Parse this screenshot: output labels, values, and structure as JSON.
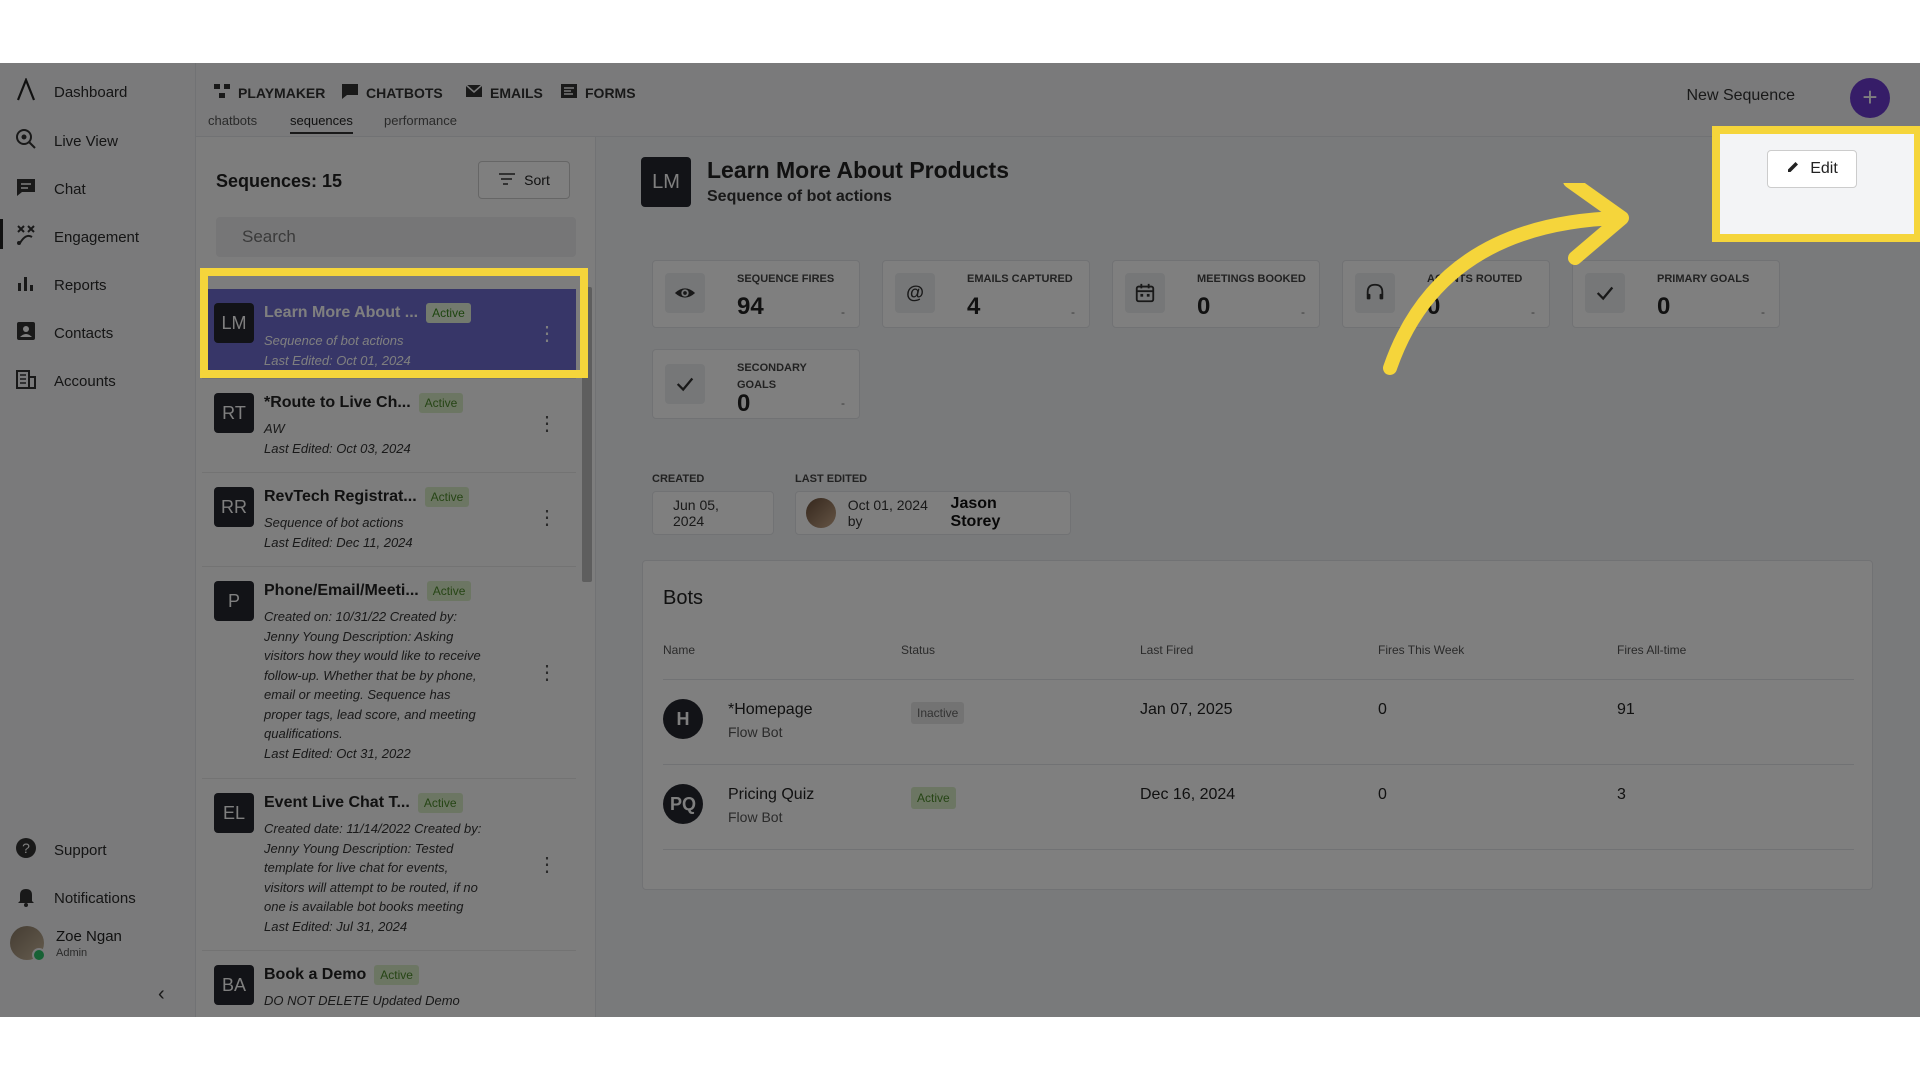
{
  "sidebar": {
    "items": [
      {
        "label": "Dashboard",
        "icon": "logo-icon"
      },
      {
        "label": "Live View",
        "icon": "live-view-icon"
      },
      {
        "label": "Chat",
        "icon": "chat-icon"
      },
      {
        "label": "Engagement",
        "icon": "engagement-icon"
      },
      {
        "label": "Reports",
        "icon": "bar-chart-icon"
      },
      {
        "label": "Contacts",
        "icon": "contacts-icon"
      },
      {
        "label": "Accounts",
        "icon": "building-icon"
      }
    ],
    "support": "Support",
    "notifications": "Notifications",
    "user": {
      "name": "Zoe Ngan",
      "role": "Admin"
    }
  },
  "topbar": {
    "tabs": [
      "PLAYMAKER",
      "CHATBOTS",
      "EMAILS",
      "FORMS"
    ],
    "subtabs": [
      "chatbots",
      "sequences",
      "performance"
    ],
    "active_subtab": "sequences",
    "new_sequence_label": "New Sequence",
    "accent": "#6c3bd1"
  },
  "list": {
    "count_label": "Sequences: 15",
    "sort_label": "Sort",
    "search_placeholder": "Search",
    "items": [
      {
        "initials": "LM",
        "title": "Learn More About ...",
        "status": "Active",
        "lines": [
          "Sequence of bot actions",
          "Last Edited: Oct 01, 2024"
        ]
      },
      {
        "initials": "RT",
        "title": "*Route to Live Ch...",
        "status": "Active",
        "lines": [
          "AW",
          "Last Edited: Oct 03, 2024"
        ]
      },
      {
        "initials": "RR",
        "title": "RevTech Registrat...",
        "status": "Active",
        "lines": [
          "Sequence of bot actions",
          "Last Edited: Dec 11, 2024"
        ]
      },
      {
        "initials": "P",
        "title": "Phone/Email/Meeti...",
        "status": "Active",
        "lines": [
          "Created on: 10/31/22 Created by:",
          "Jenny Young Description: Asking",
          "visitors how they would like to receive",
          "follow-up. Whether that be by phone,",
          "email or meeting. Sequence has",
          "proper tags, lead score, and meeting",
          "qualifications.",
          "Last Edited: Oct 31, 2022"
        ]
      },
      {
        "initials": "EL",
        "title": "Event Live Chat T...",
        "status": "Active",
        "lines": [
          "Created date: 11/14/2022 Created by:",
          "Jenny Young Description: Tested",
          "template for live chat for events,",
          "visitors will attempt to be routed, if no",
          "one is available bot books meeting",
          "Last Edited: Jul 31, 2024"
        ]
      },
      {
        "initials": "BA",
        "title": "Book a Demo",
        "status": "Active",
        "lines": [
          "DO NOT DELETE Updated Demo"
        ]
      }
    ]
  },
  "detail": {
    "initials": "LM",
    "title": "Learn More About Products",
    "subtitle": "Sequence of bot actions",
    "edit_label": "Edit",
    "stats": [
      {
        "label": "SEQUENCE FIRES",
        "value": "94",
        "icon": "eye-icon"
      },
      {
        "label": "EMAILS CAPTURED",
        "value": "4",
        "icon": "at-sign-icon"
      },
      {
        "label": "MEETINGS BOOKED",
        "value": "0",
        "icon": "calendar-icon"
      },
      {
        "label": "AGENTS ROUTED",
        "value": "0",
        "icon": "agent-icon"
      },
      {
        "label": "PRIMARY GOALS",
        "value": "0",
        "icon": "check-icon"
      },
      {
        "label": "SECONDARY GOALS",
        "value": "0",
        "icon": "check-icon"
      }
    ],
    "stat_dash": "-",
    "created_label": "CREATED",
    "created_value": "Jun 05, 2024",
    "edited_label": "LAST EDITED",
    "edited_value": "Oct 01, 2024 by",
    "edited_by": "Jason Storey"
  },
  "bots": {
    "title": "Bots",
    "columns": [
      "Name",
      "Status",
      "Last Fired",
      "Fires This Week",
      "Fires All-time"
    ],
    "rows": [
      {
        "initials": "H",
        "name": "*Homepage",
        "type": "Flow Bot",
        "status": "Inactive",
        "last_fired": "Jan 07, 2025",
        "week": "0",
        "all": "91"
      },
      {
        "initials": "PQ",
        "name": "Pricing Quiz",
        "type": "Flow Bot",
        "status": "Active",
        "last_fired": "Dec 16, 2024",
        "week": "0",
        "all": "3"
      }
    ]
  },
  "overlay": {
    "highlight_color": "#f5d53b"
  }
}
